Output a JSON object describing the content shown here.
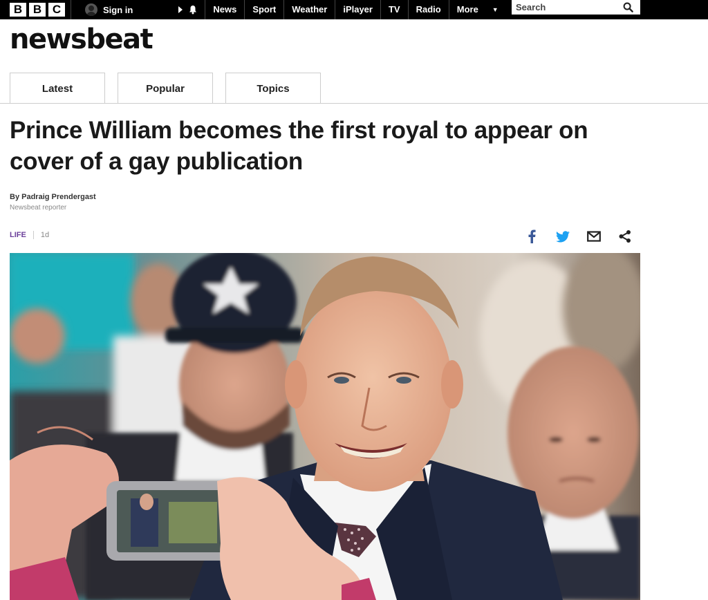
{
  "bbc_bar": {
    "logo_letters": [
      "B",
      "B",
      "C"
    ],
    "signin_label": "Sign in",
    "nav": [
      "News",
      "Sport",
      "Weather",
      "iPlayer",
      "TV",
      "Radio",
      "More"
    ],
    "search_placeholder": "Search"
  },
  "brand": "newsbeat",
  "tabs": [
    "Latest",
    "Popular",
    "Topics"
  ],
  "article": {
    "headline": "Prince William becomes the first royal to appear on cover of a gay publication",
    "byline": "By Padraig Prendergast",
    "role": "Newsbeat reporter",
    "topic": "LIFE",
    "age": "1d"
  },
  "share_icons": [
    "facebook-icon",
    "twitter-icon",
    "email-icon",
    "share-icon"
  ],
  "colors": {
    "topbar": "#000000",
    "topic": "#6b3f9a",
    "facebook": "#3b5998",
    "twitter": "#1da1f2"
  }
}
